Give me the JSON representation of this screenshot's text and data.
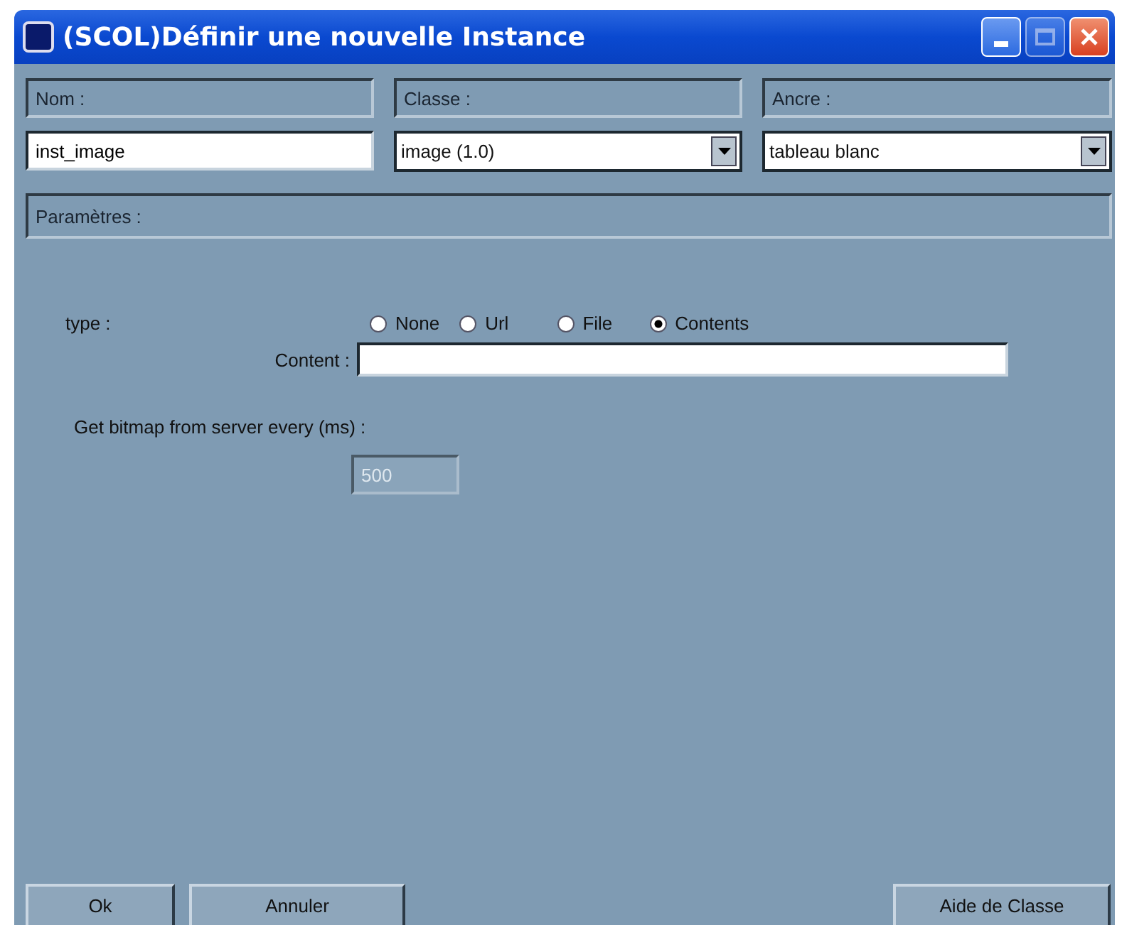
{
  "window": {
    "title": "(SCOL)Définir une nouvelle Instance"
  },
  "headers": [
    "Nom :",
    "Classe :",
    "Ancre :"
  ],
  "nom_field": {
    "value": "inst_image"
  },
  "classe_select": {
    "value": "image (1.0)"
  },
  "ancre_select": {
    "value": "tableau blanc"
  },
  "section": {
    "title": "Paramètres :"
  },
  "type_label": "type :",
  "type_options": [
    {
      "label": "None",
      "selected": false
    },
    {
      "label": "Url",
      "selected": false
    },
    {
      "label": "File",
      "selected": false
    },
    {
      "label": "Contents",
      "selected": true
    }
  ],
  "content_label": "Content :",
  "bitmap_label": "Get bitmap from server every (ms) :",
  "bitmap_field": {
    "value": "500",
    "disabled": true
  },
  "buttons": {
    "ok": "Ok",
    "cancel": "Annuler",
    "help": "Aide de Classe"
  }
}
